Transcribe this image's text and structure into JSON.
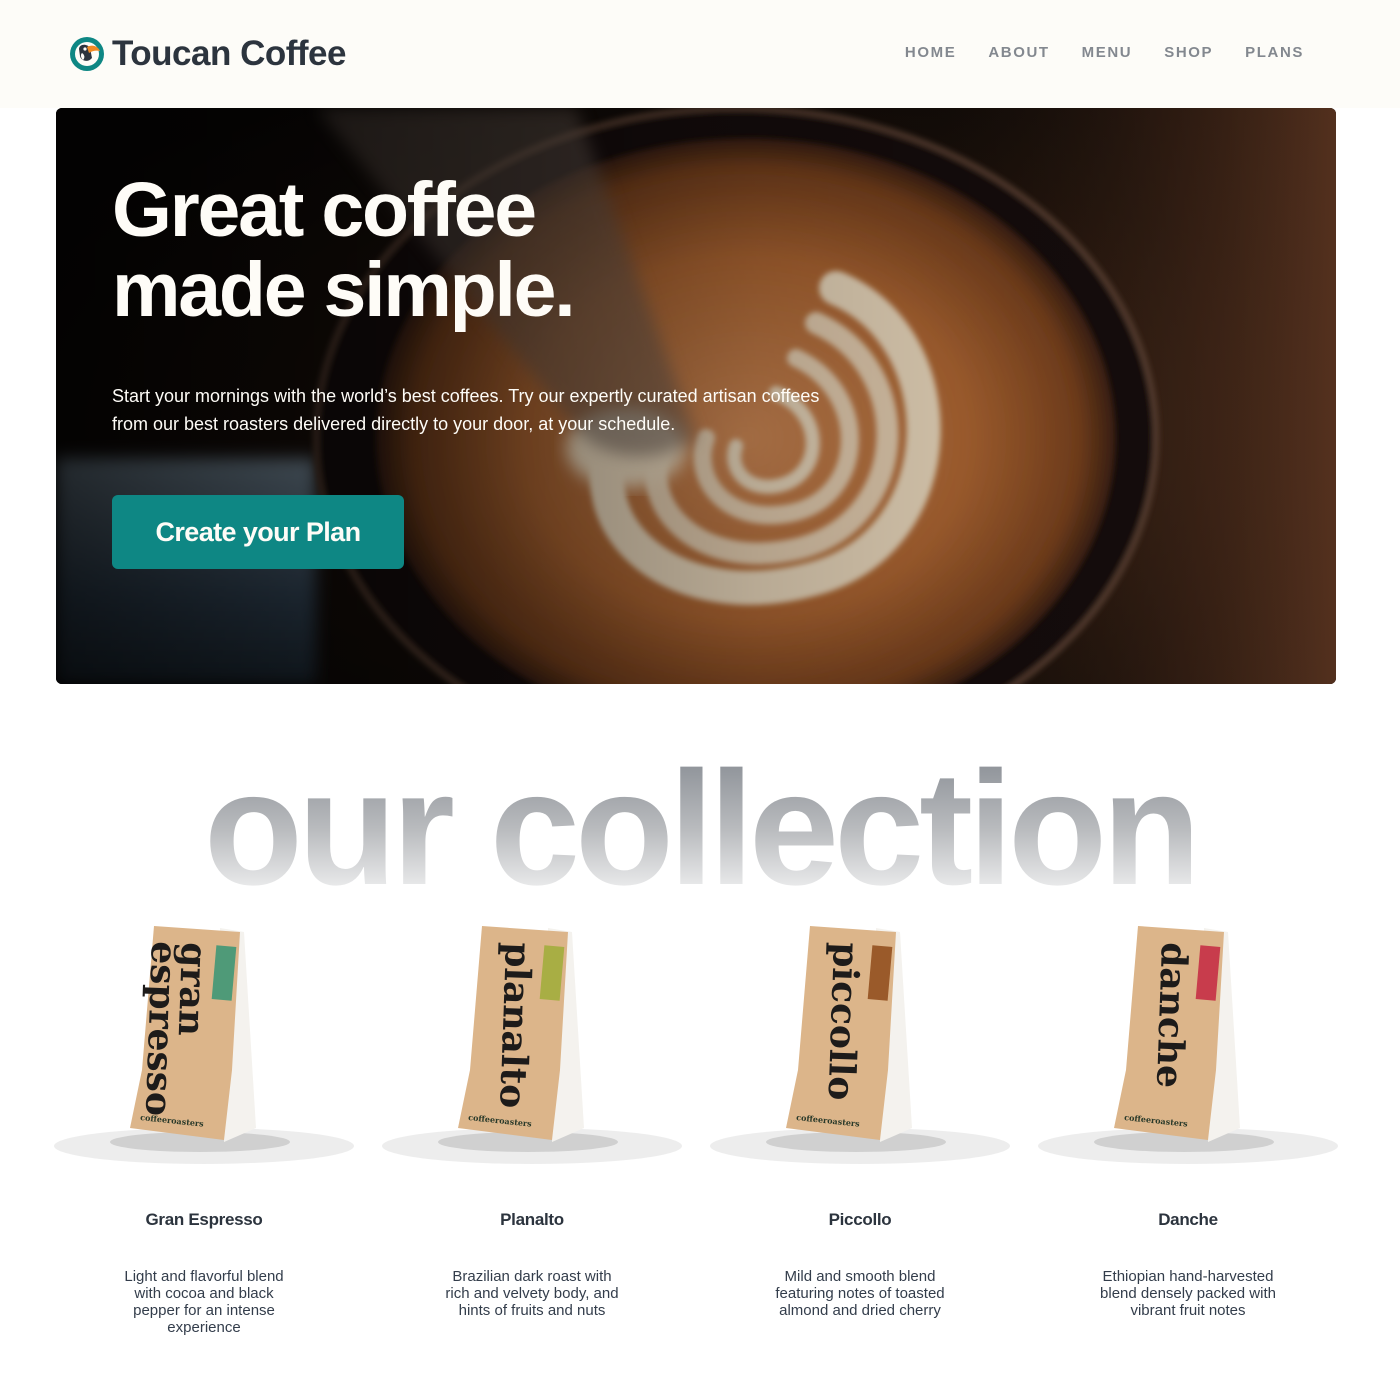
{
  "header": {
    "brand": "Toucan Coffee",
    "nav": [
      "HOME",
      "ABOUT",
      "MENU",
      "SHOP",
      "PLANS"
    ]
  },
  "hero": {
    "title_line1": "Great coffee",
    "title_line2": "made simple.",
    "text": "Start your mornings with the world’s best coffees. Try our expertly curated artisan coffees from our best roasters delivered directly to your door, at your schedule.",
    "cta": "Create your Plan"
  },
  "collection": {
    "heading": "our collection",
    "products": [
      {
        "name": "Gran Espresso",
        "bag_label_1": "gran",
        "bag_label_2": "espresso",
        "brand_mark": "coffeeroasters",
        "accent": "#4f9a78",
        "description": "Light and flavorful blend with cocoa and black pepper for an intense experience"
      },
      {
        "name": "Planalto",
        "bag_label_1": "planalto",
        "bag_label_2": "",
        "brand_mark": "coffeeroasters",
        "accent": "#a8ae44",
        "description": "Brazilian dark roast with rich and velvety body, and hints of fruits and nuts"
      },
      {
        "name": "Piccollo",
        "bag_label_1": "piccollo",
        "bag_label_2": "",
        "brand_mark": "coffeeroasters",
        "accent": "#9a5a2a",
        "description": "Mild and smooth blend featuring notes of toasted almond and dried cherry"
      },
      {
        "name": "Danche",
        "bag_label_1": "danche",
        "bag_label_2": "",
        "brand_mark": "coffeeroasters",
        "accent": "#c83c4c",
        "description": "Ethiopian hand-harvested blend densely packed with vibrant fruit notes"
      }
    ]
  },
  "colors": {
    "header_bg": "#fdfcf8",
    "cta": "#0e8784",
    "text_dark": "#2c343e",
    "nav_grey": "#83888f"
  }
}
